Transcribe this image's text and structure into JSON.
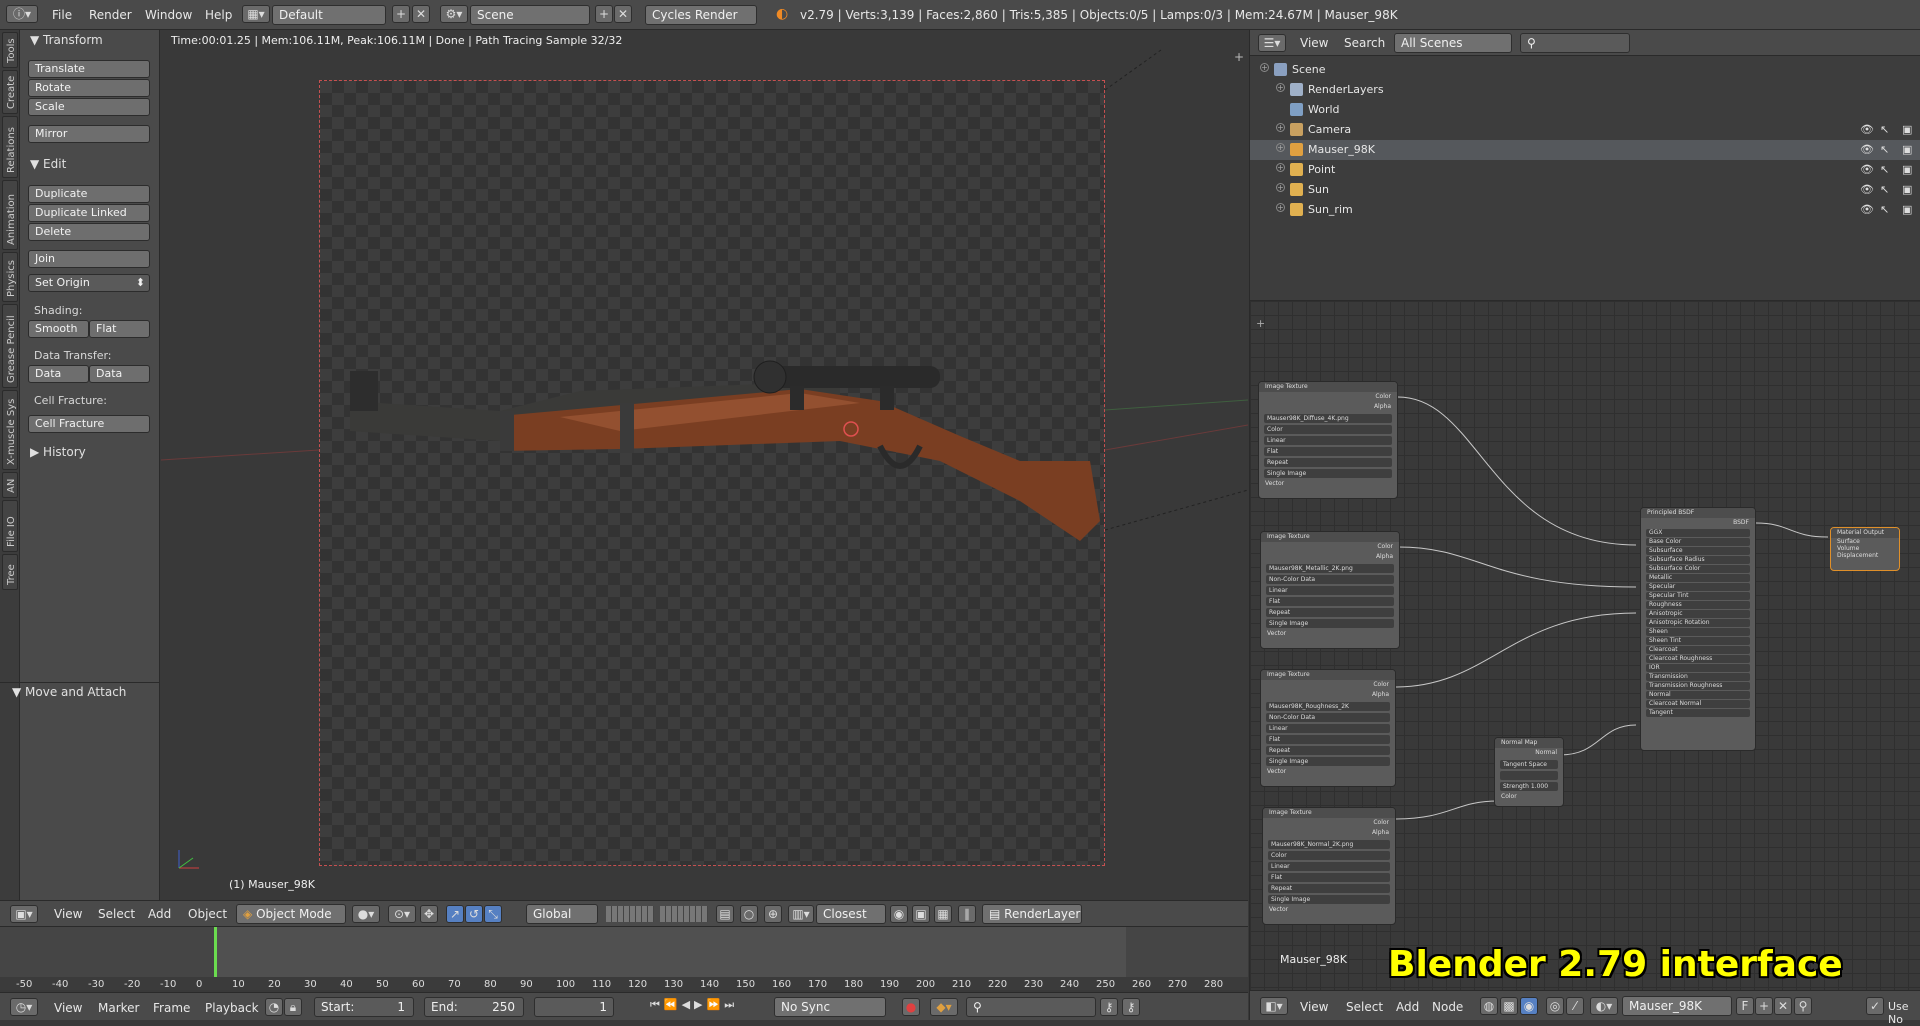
{
  "topbar": {
    "menus": [
      "File",
      "Render",
      "Window",
      "Help"
    ],
    "layout": "Default",
    "scene": "Scene",
    "engine": "Cycles Render",
    "stats": "v2.79 | Verts:3,139 | Faces:2,860 | Tris:5,385 | Objects:0/5 | Lamps:0/3 | Mem:24.67M | Mauser_98K"
  },
  "left_tabs": [
    "Tools",
    "Create",
    "Relations",
    "Animation",
    "Physics",
    "Grease Pencil",
    "X-muscle Sys",
    "AN",
    "File IO",
    "Tree"
  ],
  "toolshelf": {
    "transform_title": "Transform",
    "translate": "Translate",
    "rotate": "Rotate",
    "scale": "Scale",
    "mirror": "Mirror",
    "edit_title": "Edit",
    "duplicate": "Duplicate",
    "duplicate_linked": "Duplicate Linked",
    "delete": "Delete",
    "join": "Join",
    "set_origin": "Set Origin",
    "shading_label": "Shading:",
    "smooth": "Smooth",
    "flat": "Flat",
    "data_transfer_label": "Data Transfer:",
    "data": "Data",
    "data_layo": "Data Layo",
    "cell_fracture_label": "Cell Fracture:",
    "cell_fracture": "Cell Fracture",
    "history": "History",
    "move_attach": "Move and Attach"
  },
  "viewport": {
    "info": "Time:00:01.25 | Mem:106.11M, Peak:106.11M | Done | Path Tracing Sample 32/32",
    "object_name": "(1) Mauser_98K"
  },
  "header3d": {
    "view": "View",
    "select": "Select",
    "add": "Add",
    "object": "Object",
    "mode": "Object Mode",
    "orientation": "Global",
    "snap": "Closest",
    "render_layer": "RenderLayer"
  },
  "timeline": {
    "ticks": [
      "-50",
      "-40",
      "-30",
      "-20",
      "-10",
      "0",
      "10",
      "20",
      "30",
      "40",
      "50",
      "60",
      "70",
      "80",
      "90",
      "100",
      "110",
      "120",
      "130",
      "140",
      "150",
      "160",
      "170",
      "180",
      "190",
      "200",
      "210",
      "220",
      "230",
      "240",
      "250",
      "260",
      "270",
      "280"
    ],
    "view": "View",
    "marker": "Marker",
    "frame": "Frame",
    "playback": "Playback",
    "start_label": "Start:",
    "start_value": "1",
    "end_label": "End:",
    "end_value": "250",
    "current": "1",
    "sync": "No Sync"
  },
  "outliner": {
    "view": "View",
    "search": "Search",
    "scenes_filter": "All Scenes",
    "items": [
      {
        "label": "Scene",
        "icon": "scene-icon",
        "color": "#8aa0c0"
      },
      {
        "label": "RenderLayers",
        "icon": "renderlayers-icon",
        "color": "#9fb0c8"
      },
      {
        "label": "World",
        "icon": "world-icon",
        "color": "#7f9fc4"
      },
      {
        "label": "Camera",
        "icon": "camera-icon",
        "color": "#c8a060"
      },
      {
        "label": "Mauser_98K",
        "icon": "mesh-icon",
        "color": "#e0a040"
      },
      {
        "label": "Point",
        "icon": "lamp-icon",
        "color": "#e0b050"
      },
      {
        "label": "Sun",
        "icon": "lamp-icon",
        "color": "#e0b050"
      },
      {
        "label": "Sun_rim",
        "icon": "lamp-icon",
        "color": "#e0b050"
      }
    ]
  },
  "node_editor": {
    "material_name": "Mauser_98K",
    "tex_title": "Image Texture",
    "tex1_file": "Mauser98K_Diffuse_4K.png",
    "tex2_file": "Mauser98K_Metallic_2K.png",
    "tex3_file": "Mauser98K_Roughness_2K",
    "tex4_file": "Mauser98K_Normal_2K.png",
    "color": "Color",
    "alpha": "Alpha",
    "noncolor": "Non-Color Data",
    "linear": "Linear",
    "flat": "Flat",
    "repeat": "Repeat",
    "single": "Single Image",
    "vector": "Vector",
    "bsdf_title": "Principled BSDF",
    "bsdf_out": "BSDF",
    "bsdf_fields": [
      "GGX",
      "Base Color",
      "Subsurface",
      "Subsurface Radius",
      "Subsurface Color",
      "Metallic",
      "Specular",
      "Specular Tint",
      "Roughness",
      "Anisotropic",
      "Anisotropic Rotation",
      "Sheen",
      "Sheen Tint",
      "Clearcoat",
      "Clearcoat Roughness",
      "IOR",
      "Transmission",
      "Transmission Roughness",
      "Normal",
      "Clearcoat Normal",
      "Tangent"
    ],
    "normal_title": "Normal Map",
    "normal_fields": [
      "Normal",
      "Tangent Space",
      "",
      "Strength 1.000",
      "Color"
    ],
    "output_title": "Material Output",
    "output_fields": [
      "Surface",
      "Volume",
      "Displacement"
    ],
    "header_view": "View",
    "header_select": "Select",
    "header_add": "Add",
    "header_node": "Node",
    "header_mat": "Mauser_98K",
    "header_f": "F",
    "header_use": "Use No"
  },
  "overlay_title": "Blender 2.79 interface"
}
